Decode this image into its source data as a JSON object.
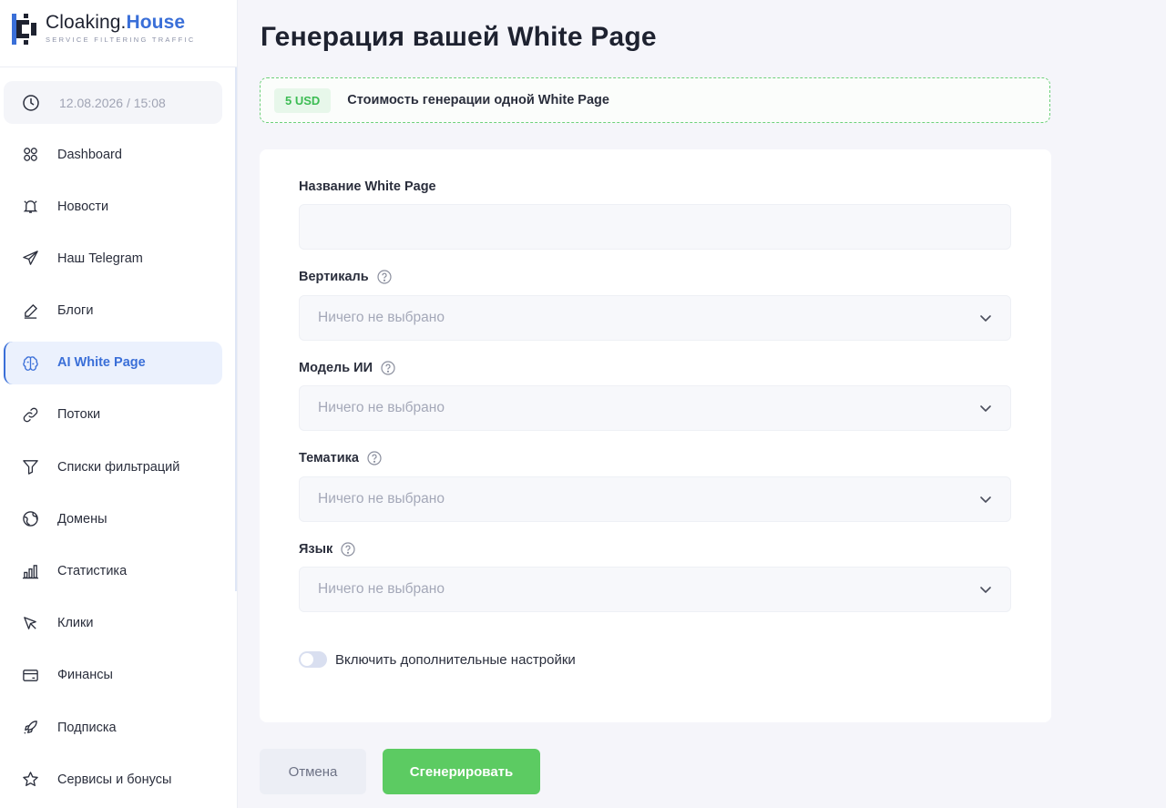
{
  "sidebar": {
    "logo": {
      "name_prefix": "Cloaking.",
      "name_highlight": "House",
      "tagline": "SERVICE FILTERING TRAFFIC"
    },
    "datetime": "12.08.2026 / 15:08",
    "items": [
      {
        "label": "Dashboard",
        "icon": "dashboard-icon"
      },
      {
        "label": "Новости",
        "icon": "bell-icon"
      },
      {
        "label": "Наш Telegram",
        "icon": "telegram-icon"
      },
      {
        "label": "Блоги",
        "icon": "pencil-icon"
      },
      {
        "label": "AI White Page",
        "icon": "brain-icon",
        "active": true
      },
      {
        "label": "Потоки",
        "icon": "link-icon"
      },
      {
        "label": "Списки фильтраций",
        "icon": "filter-icon"
      },
      {
        "label": "Домены",
        "icon": "globe-icon"
      },
      {
        "label": "Статистика",
        "icon": "bar-chart-icon"
      },
      {
        "label": "Клики",
        "icon": "cursor-icon"
      },
      {
        "label": "Финансы",
        "icon": "wallet-icon"
      },
      {
        "label": "Подписка",
        "icon": "rocket-icon"
      },
      {
        "label": "Сервисы и бонусы",
        "icon": "star-icon"
      }
    ]
  },
  "main": {
    "title": "Генерация вашей White Page",
    "price": {
      "badge": "5 USD",
      "text": "Стоимость генерации одной White Page"
    },
    "form": {
      "name_label": "Название White Page",
      "name_value": "",
      "vertical_label": "Вертикаль",
      "vertical_placeholder": "Ничего не выбрано",
      "model_label": "Модель ИИ",
      "model_placeholder": "Ничего не выбрано",
      "theme_label": "Тематика",
      "theme_placeholder": "Ничего не выбрано",
      "language_label": "Язык",
      "language_placeholder": "Ничего не выбрано",
      "advanced_toggle_label": "Включить дополнительные настройки",
      "advanced_toggle_on": false
    },
    "buttons": {
      "cancel": "Отмена",
      "generate": "Сгенерировать"
    }
  },
  "colors": {
    "accent": "#3a6fd8",
    "success": "#5ccb62",
    "badge_text": "#3cbc53"
  }
}
